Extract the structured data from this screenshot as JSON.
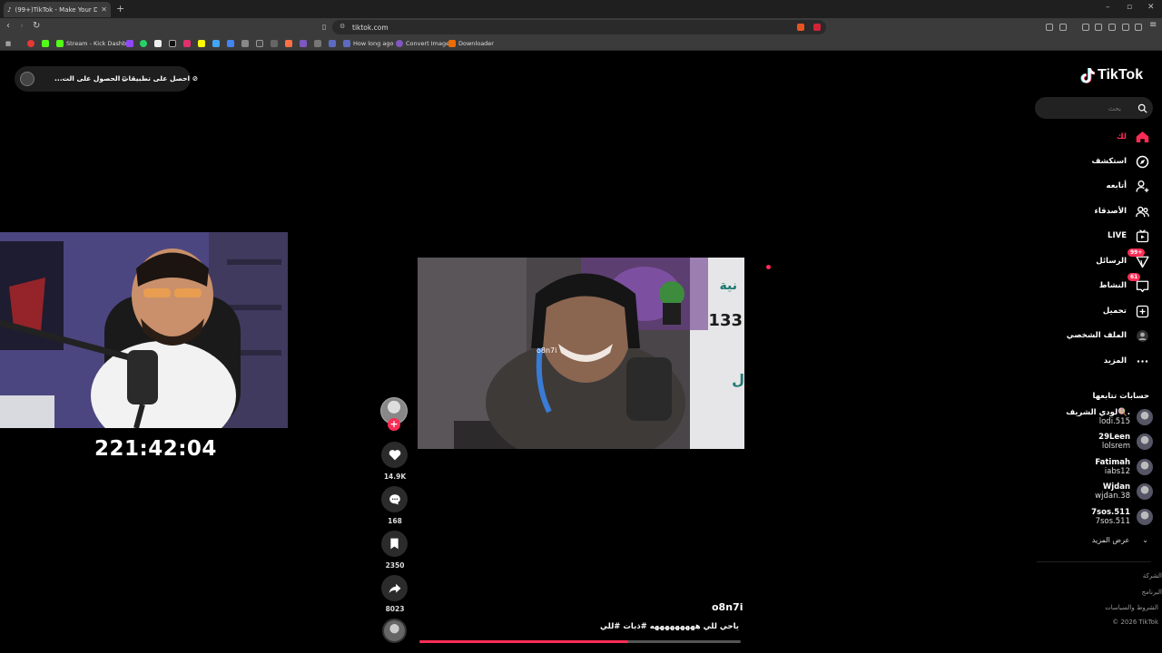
{
  "browser": {
    "tab_title": "(99+)TikTok - Make Your Day",
    "new_tab": "+",
    "url": "tiktok.com",
    "bookmarks": [
      {
        "label": "Stream - Kick Dashb...",
        "color": "#53fc18"
      },
      {
        "label": "How long ago",
        "color": "#5c6bc0"
      },
      {
        "label": "Convert Image",
        "color": "#7e57c2"
      },
      {
        "label": "Downloader",
        "color": "#ef6c00"
      }
    ]
  },
  "top_left": {
    "get_apps": "احصل على تطبيقات",
    "get_pc_app": "الحصول على الت..."
  },
  "left_video": {
    "timer": "221:42:04"
  },
  "video": {
    "watermark": "o8n7i",
    "username": "o8n7i",
    "caption": "ياحي للي هههههههههه #ذبات #للي",
    "progress": 0.65
  },
  "actions": {
    "likes": "14.9K",
    "comments": "168",
    "saves": "2350",
    "shares": "8023"
  },
  "sidebar": {
    "logo_text": "TikTok",
    "search_placeholder": "بحث",
    "nav": [
      {
        "label": "لك",
        "icon": "home-icon",
        "active": true
      },
      {
        "label": "استكشف",
        "icon": "compass-icon"
      },
      {
        "label": "أتابعه",
        "icon": "user-follow-icon"
      },
      {
        "label": "الأصدقاء",
        "icon": "friends-icon"
      },
      {
        "label": "LIVE",
        "icon": "live-icon"
      },
      {
        "label": "الرسائل",
        "icon": "messages-icon",
        "badge": "99+"
      },
      {
        "label": "النشاط",
        "icon": "activity-icon",
        "badge": "61"
      },
      {
        "label": "تحميل",
        "icon": "upload-icon"
      },
      {
        "label": "الملف الشخصي",
        "icon": "profile-icon"
      },
      {
        "label": "المزيد",
        "icon": "more-icon"
      }
    ],
    "following_title": "حسابات تتابعها",
    "following": [
      {
        "name": "لودي الشريف🍭.",
        "handle": "lodi.515"
      },
      {
        "name": "29Leen",
        "handle": "lolsrem"
      },
      {
        "name": "Fatimah",
        "handle": "iabs12"
      },
      {
        "name": "Wjdan",
        "handle": "wjdan.38"
      },
      {
        "name": "7sos.511",
        "handle": "7sos.511"
      }
    ],
    "see_more": "عرض المزيد",
    "footer": [
      "الشركة",
      "البرنامج",
      "الشروط والسياسات",
      "© 2026 TikTok"
    ]
  },
  "colors": {
    "accent": "#fe2c55",
    "background": "#000000"
  }
}
